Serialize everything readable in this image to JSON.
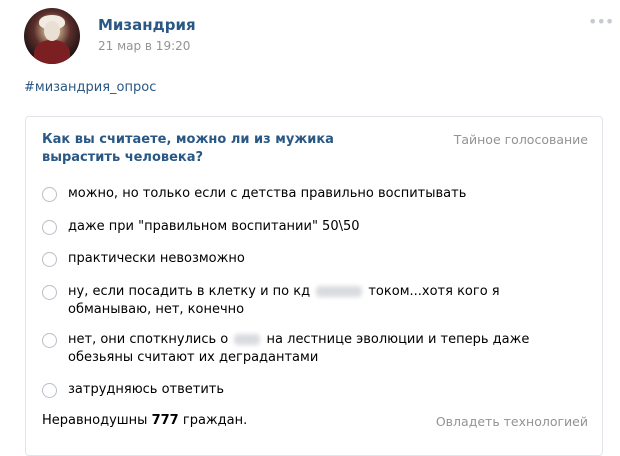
{
  "post": {
    "author": "Мизандрия",
    "date": "21 мар в 19:20",
    "hashtag": "#мизандрия_опрос",
    "more_icon": "ellipsis-icon"
  },
  "poll": {
    "question": "Как вы считаете, можно ли из мужика вырастить человека?",
    "type": "Тайное голосование",
    "options": [
      {
        "text": "можно, но только если с детства правильно воспитывать"
      },
      {
        "text": "даже при \"правильном воспитании\" 50\\50"
      },
      {
        "text": "практически невозможно"
      },
      {
        "text_before": "ну, если посадить в клетку и по кд",
        "text_after": "током...хотя кого я обманываю, нет, конечно"
      },
      {
        "text_before": "нет, они споткнулись о",
        "text_after": "на лестнице эволюции и теперь даже обезьяны считают их деградантами"
      },
      {
        "text": "затрудняюсь ответить"
      }
    ],
    "footer_prefix": "Неравнодушны",
    "voters_count": "777",
    "footer_suffix": "граждан.",
    "action": "Овладеть технологией"
  }
}
